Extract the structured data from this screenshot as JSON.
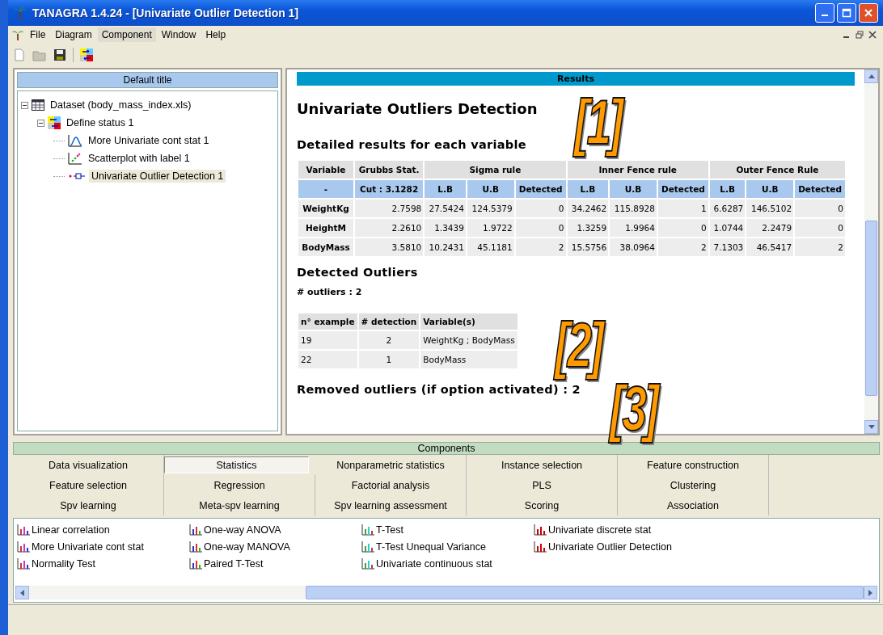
{
  "window": {
    "title": "TANAGRA 1.4.24 - [Univariate Outlier Detection 1]"
  },
  "menu": [
    "File",
    "Diagram",
    "Component",
    "Window",
    "Help"
  ],
  "menu_selected": [
    false,
    false,
    true,
    false,
    false
  ],
  "tree_panel": {
    "title": "Default title",
    "items": [
      {
        "label": "Dataset (body_mass_index.xls)",
        "kind": "dataset",
        "expanded": true,
        "selected": false,
        "children": [
          {
            "label": "Define status 1",
            "kind": "status",
            "expanded": true,
            "selected": false,
            "children": [
              {
                "label": "More Univariate cont stat 1",
                "kind": "curve",
                "selected": false
              },
              {
                "label": "Scatterplot with label 1",
                "kind": "scatter",
                "selected": false
              },
              {
                "label": "Univariate Outlier Detection 1",
                "kind": "outlier",
                "selected": true
              }
            ]
          }
        ]
      }
    ]
  },
  "results": {
    "bar": "Results",
    "title": "Univariate Outliers Detection",
    "section_1": "Detailed results for each variable",
    "table_1": {
      "groups": [
        {
          "label": "Variable",
          "subheaders": [
            "-"
          ]
        },
        {
          "label": "Grubbs Stat.",
          "subheaders": [
            "Cut : 3.1282"
          ]
        },
        {
          "label": "Sigma rule",
          "subheaders": [
            "L.B",
            "U.B",
            "Detected"
          ]
        },
        {
          "label": "Inner Fence rule",
          "subheaders": [
            "L.B",
            "U.B",
            "Detected"
          ]
        },
        {
          "label": "Outer Fence Rule",
          "subheaders": [
            "L.B",
            "U.B",
            "Detected"
          ]
        }
      ],
      "rows": [
        [
          "WeightKg",
          "2.7598",
          "27.5424",
          "124.5379",
          "0",
          "34.2462",
          "115.8928",
          "1",
          "6.6287",
          "146.5102",
          "0"
        ],
        [
          "HeightM",
          "2.2610",
          "1.3439",
          "1.9722",
          "0",
          "1.3259",
          "1.9964",
          "0",
          "1.0744",
          "2.2479",
          "0"
        ],
        [
          "BodyMass",
          "3.5810",
          "10.2431",
          "45.1181",
          "2",
          "15.5756",
          "38.0964",
          "2",
          "7.1303",
          "46.5417",
          "2"
        ]
      ]
    },
    "section_2": "Detected Outliers",
    "count": "# outliers : 2",
    "table_2": {
      "columns": [
        "n° example",
        "# detection",
        "Variable(s)"
      ],
      "rows": [
        [
          "19",
          "2",
          "WeightKg ; BodyMass"
        ],
        [
          "22",
          "1",
          "BodyMass"
        ]
      ]
    },
    "section_3": "Removed outliers (if option activated) : 2"
  },
  "components": {
    "title": "Components",
    "tabs": [
      {
        "label": "Data visualization",
        "selected": false
      },
      {
        "label": "Statistics",
        "selected": true
      },
      {
        "label": "Nonparametric statistics",
        "selected": false
      },
      {
        "label": "Instance selection",
        "selected": false
      },
      {
        "label": "Feature construction",
        "selected": false
      },
      {
        "label": "Feature selection",
        "selected": false
      },
      {
        "label": "Regression",
        "selected": false
      },
      {
        "label": "Factorial analysis",
        "selected": false
      },
      {
        "label": "PLS",
        "selected": false
      },
      {
        "label": "Clustering",
        "selected": false
      },
      {
        "label": "Spv learning",
        "selected": false
      },
      {
        "label": "Meta-spv learning",
        "selected": false
      },
      {
        "label": "Spv learning assessment",
        "selected": false
      },
      {
        "label": "Scoring",
        "selected": false
      },
      {
        "label": "Association",
        "selected": false
      }
    ],
    "columns": [
      [
        "Linear correlation",
        "More Univariate cont stat",
        "Normality Test"
      ],
      [
        "One-way ANOVA",
        "One-way MANOVA",
        "Paired T-Test"
      ],
      [
        "T-Test",
        "T-Test Unequal Variance",
        "Univariate continuous stat"
      ],
      [
        "Univariate discrete stat",
        "Univariate Outlier Detection"
      ]
    ]
  },
  "callouts": [
    "[1]",
    "[2]",
    "[3]"
  ]
}
